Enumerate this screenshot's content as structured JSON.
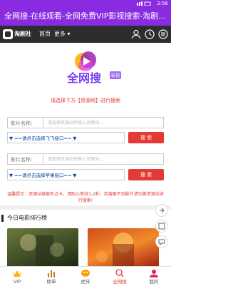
{
  "status": {
    "time": "2:56"
  },
  "app": {
    "title": "全网搜-在线观看-全网免费VIP影视搜索-淘剧..."
  },
  "navbar": {
    "logo_text": "淘剧社",
    "home": "首页",
    "more": "更多 ▾"
  },
  "brand": {
    "title": "全网搜",
    "badge": "影视"
  },
  "notice": "请选择下方【资源网】进行搜索",
  "form1": {
    "label": "影片名称:",
    "placeholder": "请选择资源站并输入关键词...",
    "select": "▼ ==请点击选择飞飞接口== ▼",
    "button": "搜 索"
  },
  "form2": {
    "label": "影片名称:",
    "placeholder": "请选择资源站并输入关键词...",
    "select": "▼ ==请点击选择苹果接口== ▼",
    "button": "搜 索"
  },
  "tip": "温馨提示：资源站搜索有点卡，请耐心等待1-2秒，若搜索不到影片请切换资源站进行搜索!",
  "section": {
    "title": "今日电影排行榜"
  },
  "bottom_nav": [
    {
      "label": "VIP",
      "icon": "vip-icon"
    },
    {
      "label": "榜单",
      "icon": "chart-icon"
    },
    {
      "label": "虎牙",
      "icon": "huya-icon"
    },
    {
      "label": "全网搜",
      "icon": "search-icon"
    },
    {
      "label": "我的",
      "icon": "user-icon"
    }
  ],
  "colors": {
    "header": "#8a2be2",
    "accent": "#e53935",
    "nav": "#2d2d2d"
  }
}
